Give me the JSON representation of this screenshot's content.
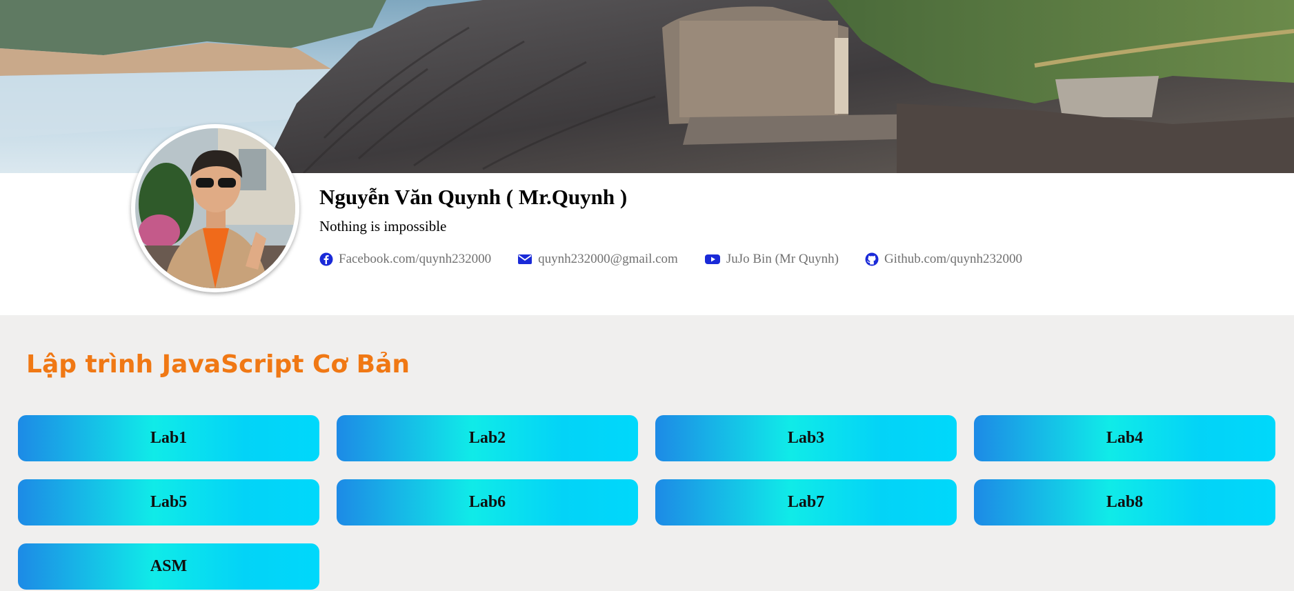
{
  "profile": {
    "name": "Nguyễn Văn Quynh ( Mr.Quynh )",
    "motto": "Nothing is impossible",
    "contacts": [
      {
        "icon": "facebook-icon",
        "label": "Facebook.com/quynh232000"
      },
      {
        "icon": "envelope-icon",
        "label": "quynh232000@gmail.com"
      },
      {
        "icon": "youtube-icon",
        "label": "JuJo Bin (Mr Quynh)"
      },
      {
        "icon": "github-icon",
        "label": "Github.com/quynh232000"
      }
    ]
  },
  "section": {
    "title": "Lập trình JavaScript Cơ Bản"
  },
  "labs": [
    {
      "label": "Lab1"
    },
    {
      "label": "Lab2"
    },
    {
      "label": "Lab3"
    },
    {
      "label": "Lab4"
    },
    {
      "label": "Lab5"
    },
    {
      "label": "Lab6"
    },
    {
      "label": "Lab7"
    },
    {
      "label": "Lab8"
    },
    {
      "label": "ASM"
    }
  ],
  "colors": {
    "accent_title": "#f07814",
    "icon_blue": "#1a2ad8",
    "button_gradient": [
      "#1d8ae6",
      "#10ebe8",
      "#00d8fb"
    ],
    "page_background": "#f0efee"
  }
}
